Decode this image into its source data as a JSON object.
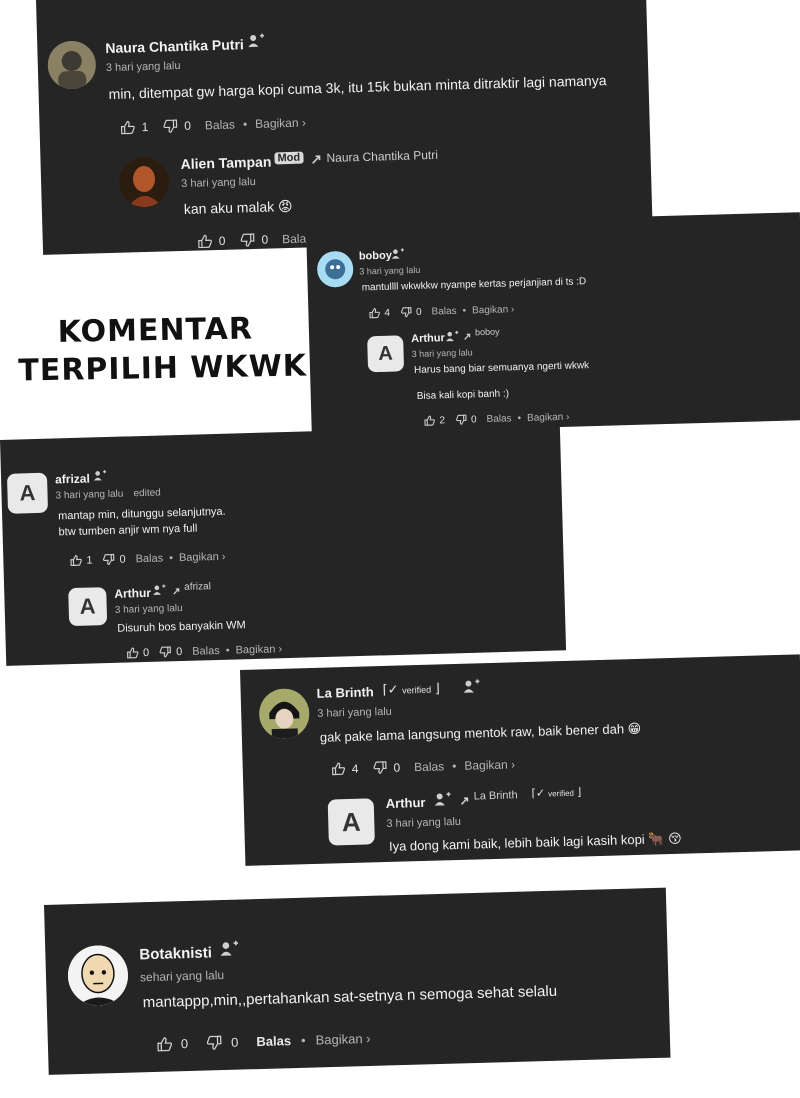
{
  "caption": {
    "line1": "KOMENTAR",
    "line2": "TERPILIH WKWK"
  },
  "labels": {
    "reply": "Balas",
    "share": "Bagikan ›",
    "mod_badge": "Mod",
    "edited": "edited"
  },
  "comments": [
    {
      "author": "Naura Chantika Putri",
      "time": "3 hari yang lalu",
      "text": "min, ditempat gw harga kopi cuma 3k, itu 15k bukan minta ditraktir lagi namanya",
      "likes": "1",
      "dislikes": "0",
      "reply": {
        "author": "Alien Tampan",
        "badge": "Mod",
        "reply_to": "Naura Chantika Putri",
        "time": "3 hari yang lalu",
        "text": "kan aku malak 😡",
        "likes": "0",
        "dislikes": "0"
      }
    },
    {
      "author": "boboy",
      "time": "3 hari yang lalu",
      "text": "mantullll wkwkkw nyampe kertas perjanjian di ts :D",
      "likes": "4",
      "dislikes": "0",
      "reply": {
        "avatar_letter": "A",
        "author": "Arthur",
        "reply_to": "boboy",
        "time": "3 hari yang lalu",
        "text": "Harus bang biar semuanya ngerti wkwk",
        "text2": "Bisa kali kopi banh :)",
        "likes": "2",
        "dislikes": "0"
      }
    },
    {
      "avatar_letter": "A",
      "author": "afrizal",
      "time": "3 hari yang lalu",
      "edited": "edited",
      "text": "mantap min, ditunggu selanjutnya.",
      "text2": "btw tumben anjir wm nya full",
      "likes": "1",
      "dislikes": "0",
      "reply": {
        "avatar_letter": "A",
        "author": "Arthur",
        "reply_to": "afrizal",
        "time": "3 hari yang lalu",
        "text": "Disuruh bos banyakin WM",
        "likes": "0",
        "dislikes": "0"
      }
    },
    {
      "author": "La Brinth",
      "verified": "verified",
      "time": "3 hari yang lalu",
      "text": "gak pake lama langsung mentok raw, baik bener dah 😁",
      "likes": "4",
      "dislikes": "0",
      "reply": {
        "avatar_letter": "A",
        "author": "Arthur",
        "reply_to": "La Brinth",
        "verified": "verified",
        "time": "3 hari yang lalu",
        "text": "Iya dong kami baik, lebih baik lagi kasih kopi 🐂 😚"
      }
    },
    {
      "author": "Botaknisti",
      "time": "sehari yang lalu",
      "text": "mantappp,min,,pertahankan sat-setnya n semoga sehat selalu",
      "likes": "0",
      "dislikes": "0"
    }
  ]
}
